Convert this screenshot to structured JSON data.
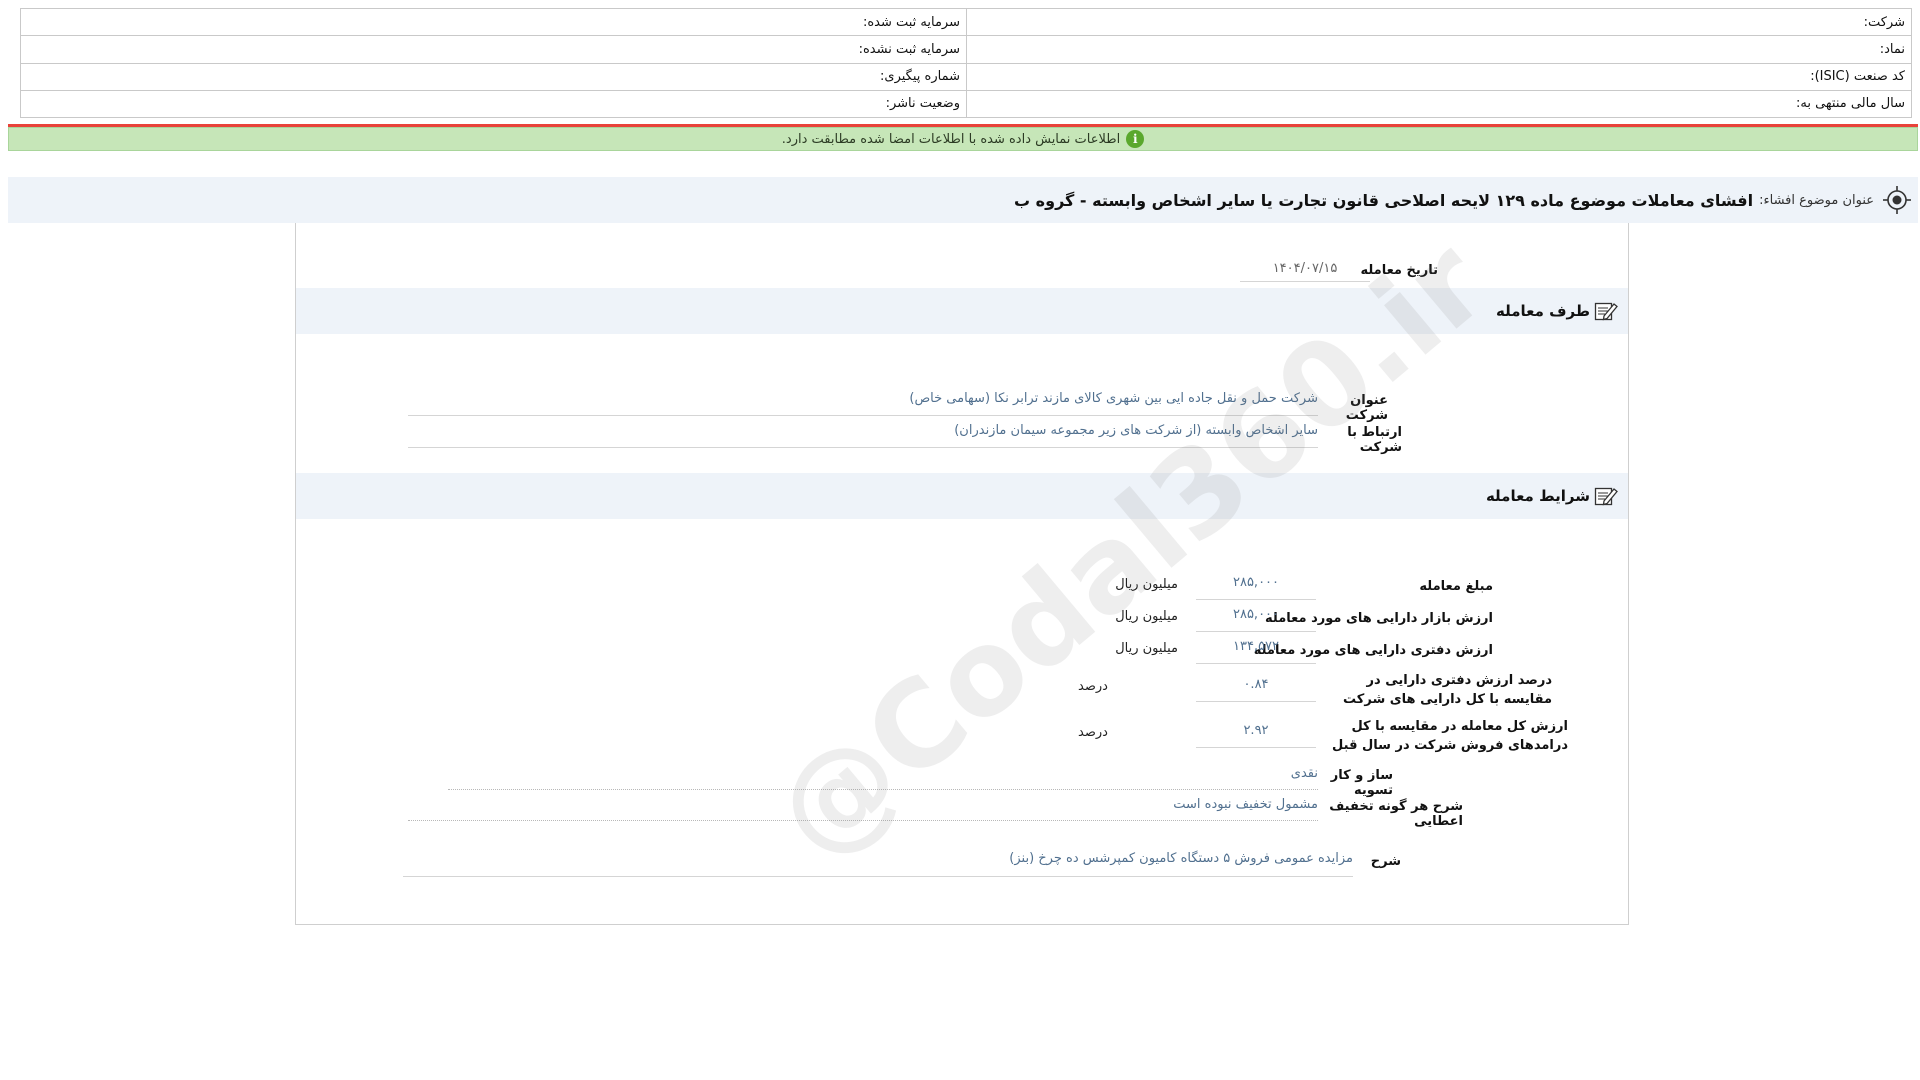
{
  "header": {
    "rows": [
      {
        "right": "شرکت:",
        "left": "سرمایه ثبت شده:"
      },
      {
        "right": "نماد:",
        "left": "سرمایه ثبت نشده:"
      },
      {
        "right": "کد صنعت (ISIC):",
        "left": "شماره پیگیری:"
      },
      {
        "right": "سال مالی منتهی به:",
        "left": "وضعیت ناشر:"
      }
    ]
  },
  "status": {
    "message": "اطلاعات نمایش داده شده با اطلاعات امضا شده مطابقت دارد.",
    "icon": "info-icon",
    "color": "#c6e6b8"
  },
  "subject": {
    "label": "عنوان موضوع افشاء:",
    "value": "افشای معاملات موضوع ماده ۱۲۹ لایحه اصلاحی قانون تجارت یا سایر اشخاص وابسته - گروه ب"
  },
  "transaction_date": {
    "label": "تاریخ معامله",
    "value": "۱۴۰۴/۰۷/۱۵"
  },
  "party": {
    "title": "طرف معامله",
    "company_label": "عنوان شرکت",
    "company_value": "شرکت حمل و نقل جاده ایی بین شهری کالای مازند ترابر نکا (سهامی خاص)",
    "relation_label": "ارتباط با شرکت",
    "relation_value": "سایر اشخاص وابسته (از شرکت های زیر مجموعه سیمان مازندران)"
  },
  "terms": {
    "title": "شرایط معامله",
    "rows": [
      {
        "label": "مبلغ معامله",
        "value": "۲۸۵,۰۰۰",
        "unit": "میلیون ریال"
      },
      {
        "label": "ارزش بازار دارایی های مورد معامله",
        "value": "۲۸۵,۰۰۰",
        "unit": "میلیون ریال"
      },
      {
        "label": "ارزش دفتری دارایی های مورد معامله",
        "value": "۱۳۴,۵۷۲",
        "unit": "میلیون ریال"
      },
      {
        "label": "درصد ارزش دفتری دارایی در مقایسه با کل دارایی های شرکت",
        "value": "۰.۸۴",
        "unit": "درصد"
      },
      {
        "label": "ارزش کل معامله در مقایسه با کل درامدهای فروش شرکت در سال قبل",
        "value": "۲.۹۲",
        "unit": "درصد"
      }
    ],
    "settlement_label": "ساز و کار تسویه",
    "settlement_value": "نقدی",
    "discount_label": "شرح هر گونه تخفیف اعطایی",
    "discount_value": "مشمول تخفیف نبوده است",
    "desc_label": "شرح",
    "desc_value": "مزایده عمومی فروش ۵ دستگاه کامیون کمپرشس ده چرخ (بنز)"
  },
  "watermark": "@Codal360.ir"
}
